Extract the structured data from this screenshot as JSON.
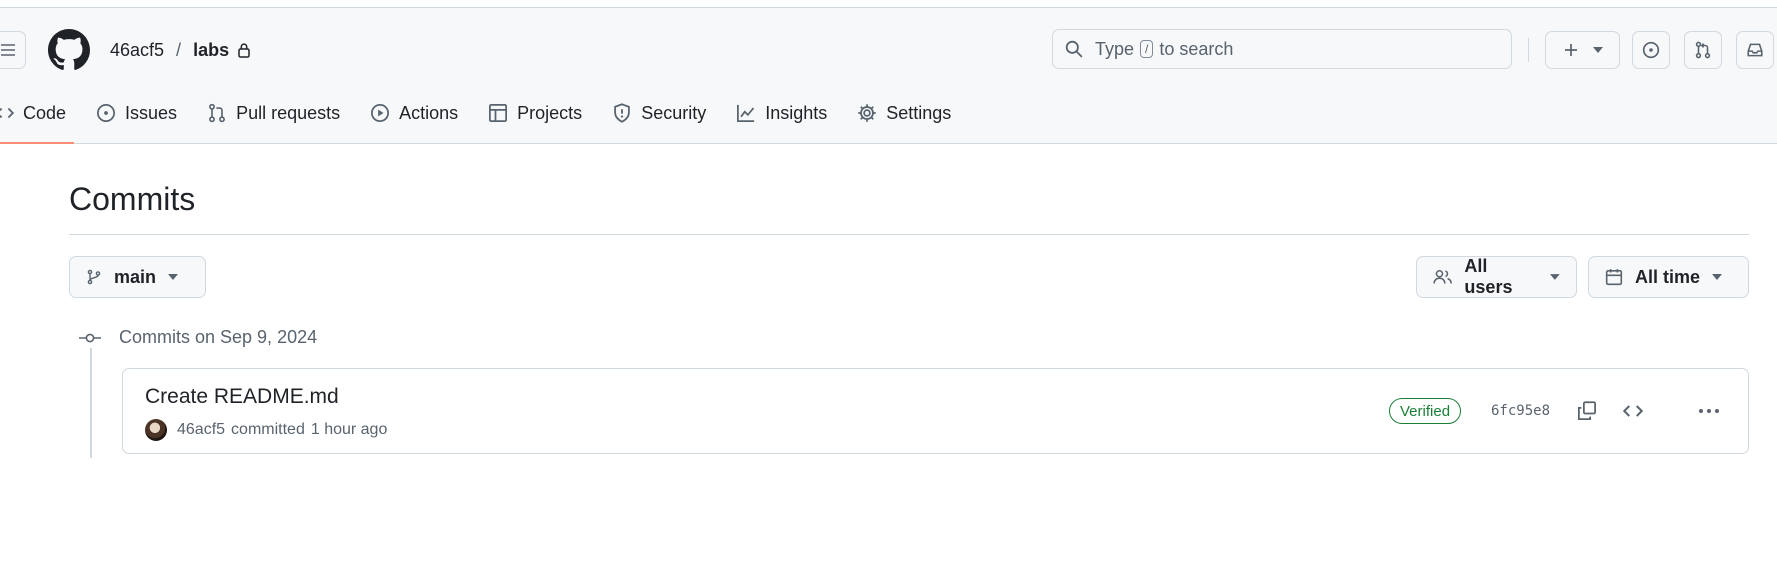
{
  "header": {
    "owner": "46acf5",
    "separator": "/",
    "repo": "labs",
    "search": {
      "prefix": "Type",
      "key": "/",
      "suffix": "to search"
    }
  },
  "nav": [
    {
      "label": "Code",
      "icon": "code-icon",
      "selected": true
    },
    {
      "label": "Issues",
      "icon": "issue-icon"
    },
    {
      "label": "Pull requests",
      "icon": "pull-request-icon"
    },
    {
      "label": "Actions",
      "icon": "play-icon"
    },
    {
      "label": "Projects",
      "icon": "table-icon"
    },
    {
      "label": "Security",
      "icon": "shield-icon"
    },
    {
      "label": "Insights",
      "icon": "graph-icon"
    },
    {
      "label": "Settings",
      "icon": "gear-icon"
    }
  ],
  "page": {
    "title": "Commits",
    "branch": "main",
    "users_filter": "All users",
    "time_filter": "All time"
  },
  "group": {
    "heading": "Commits on Sep 9, 2024",
    "commits": [
      {
        "title": "Create README.md",
        "author": "46acf5",
        "action": "committed",
        "when": "1 hour ago",
        "badge": "Verified",
        "sha": "6fc95e8"
      }
    ]
  },
  "colors": {
    "accent_underline": "#fd8c73",
    "verified": "#1a7f37",
    "border": "#d1d9e0",
    "muted": "#59636e"
  }
}
